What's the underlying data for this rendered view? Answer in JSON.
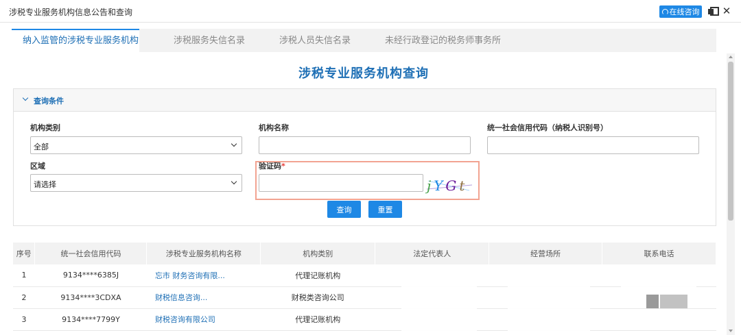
{
  "window": {
    "title": "涉税专业服务机构信息公告和查询",
    "online_consult": "在线咨询"
  },
  "tabs": [
    {
      "label": "纳入监管的涉税专业服务机构",
      "active": true
    },
    {
      "label": "涉税服务失信名录",
      "active": false
    },
    {
      "label": "涉税人员失信名录",
      "active": false
    },
    {
      "label": "未经行政登记的税务师事务所",
      "active": false
    }
  ],
  "page_title": "涉税专业服务机构查询",
  "query": {
    "header": "查询条件",
    "org_type_label": "机构类别",
    "org_type_value": "全部",
    "org_name_label": "机构名称",
    "org_name_value": "",
    "credit_code_label": "统一社会信用代码（纳税人识别号）",
    "credit_code_value": "",
    "region_label": "区域",
    "region_value": "请选择",
    "captcha_label": "验证码",
    "captcha_required": "*",
    "captcha_value": "",
    "captcha_text": "jYGt",
    "search_btn": "查询",
    "reset_btn": "重置"
  },
  "table": {
    "headers": [
      "序号",
      "统一社会信用代码",
      "涉税专业服务机构名称",
      "机构类别",
      "法定代表人",
      "经营场所",
      "联系电话"
    ],
    "rows": [
      {
        "no": "1",
        "code": "9134****6385J",
        "name": "忘市    财务咨询有限...",
        "type": "代理记账机构"
      },
      {
        "no": "2",
        "code": "9134****3CDXA",
        "name": "财税信息咨询...",
        "type": "财税类咨询公司"
      },
      {
        "no": "3",
        "code": "9134****7799Y",
        "name": "财税咨询有限公司",
        "type": "代理记账机构"
      }
    ]
  },
  "colors": {
    "accent": "#1e88e5",
    "title_blue": "#1e6fb5",
    "highlight_border": "#f2a391"
  }
}
